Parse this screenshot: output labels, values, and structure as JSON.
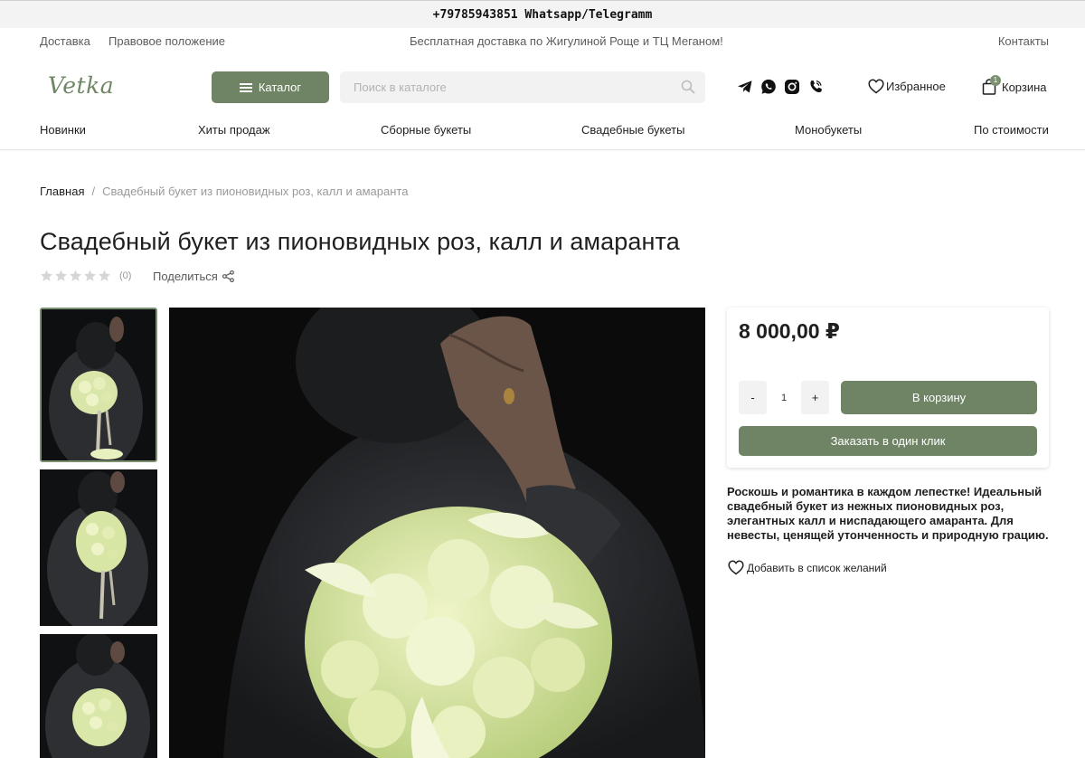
{
  "topbar": {
    "phone": "+79785943851 Whatsapp/Telegramm"
  },
  "utility_nav": {
    "delivery": "Доставка",
    "legal": "Правовое положение",
    "promo": "Бесплатная доставка по Жигулиной Роще и ТЦ Меганом!",
    "contacts": "Контакты"
  },
  "header": {
    "logo": "Vetka",
    "catalog_label": "Каталог",
    "search_placeholder": "Поиск в каталоге",
    "favorites_label": "Избранное",
    "cart_label": "Корзина",
    "cart_count": "1",
    "social_icons": [
      "telegram-icon",
      "whatsapp-icon",
      "instagram-icon",
      "viber-icon"
    ]
  },
  "category_nav": [
    "Новинки",
    "Хиты продаж",
    "Сборные букеты",
    "Свадебные букеты",
    "Монобукеты",
    "По стоимости"
  ],
  "breadcrumb": {
    "home": "Главная",
    "separator": "/",
    "current": "Свадебный букет из пионовидных роз, калл и амаранта"
  },
  "product": {
    "title": "Свадебный букет из пионовидных роз, калл и амаранта",
    "rating_value": 0,
    "rating_count": "(0)",
    "share_label": "Поделиться",
    "price": "8 000,00 ₽",
    "quantity": "1",
    "minus_label": "-",
    "plus_label": "+",
    "add_to_cart_label": "В корзину",
    "one_click_label": "Заказать в один клик",
    "description": "Роскошь и романтика в каждом лепестке! Идеальный свадебный букет из нежных пионовидных роз, элегантных калл и ниспадающего амаранта. Для невесты, ценящей утонченность и природную грацию.",
    "wishlist_label": "Добавить в список желаний"
  },
  "colors": {
    "accent": "#6f8464",
    "logo": "#6f8664",
    "muted": "#9a9a9a"
  }
}
